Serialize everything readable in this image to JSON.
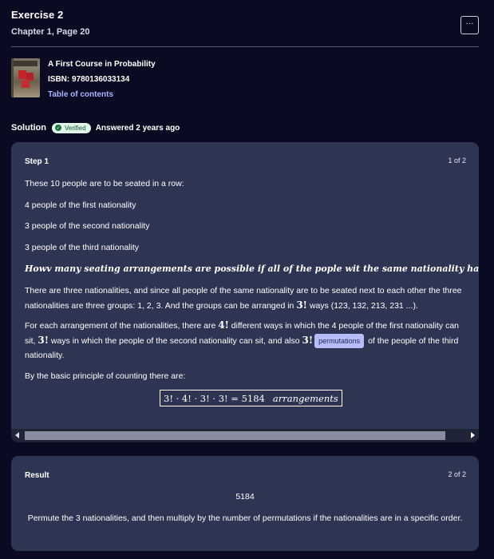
{
  "header": {
    "title": "Exercise 2",
    "subtitle": "Chapter 1, Page 20",
    "more_label": "···"
  },
  "book": {
    "title": "A First Course in Probability",
    "isbn": "ISBN: 9780136033134",
    "toc_link": "Table of contents"
  },
  "solution": {
    "label": "Solution",
    "verified": "Verified",
    "answered": "Answered 2 years ago"
  },
  "step1": {
    "label": "Step 1",
    "counter": "1 of 2",
    "intro": "These 10 people are to be seated in a row:",
    "groups": [
      "4 people of the first nationality",
      "3 people of the second nationality",
      "3 people of the third nationality"
    ],
    "question": "Howv many seating arrangements are possible if all of the pople wit the same nationality have to sit together?",
    "para1_a": "There are three nationalities, and since all people of the same nationality are to be seated next to each other the three nationalities are three groups: 1, 2, 3. And the groups can be arranged in ",
    "para1_math": "3!",
    "para1_b": " ways (123, 132, 213, 231 ...).",
    "para2_a": "For each arrangement of the nationalities, there are ",
    "para2_math1": "4!",
    "para2_b": " different ways in which the 4 people of the first nationality can sit, ",
    "para2_math2": "3!",
    "para2_c": " ways in which the people of the second nationality can sit, and also ",
    "para2_math3": "3!",
    "para2_chip": "permutations",
    "para2_d": " of the people of the third nationality.",
    "para3": "By the basic principle of counting there are:",
    "formula": "3! · 4! · 3! · 3! = 5184",
    "formula_unit": "arrangements"
  },
  "result": {
    "label": "Result",
    "counter": "2 of 2",
    "value": "5184",
    "explanation": "Permute the 3 nationalities, and then multiply by the number of permutations if the nationalities are in a specific order."
  },
  "colors": {
    "background": "#0a0a23",
    "card": "#2e3553",
    "accent_link": "#a9b5ff",
    "chip": "#b6bdfa",
    "verified_bg": "#dff7e9"
  }
}
